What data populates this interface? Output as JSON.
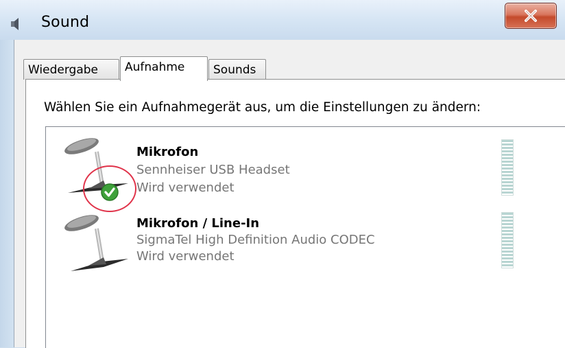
{
  "window": {
    "title": "Sound",
    "icon": "speaker-icon",
    "close_icon": "close-icon"
  },
  "tabs": [
    {
      "label": "Wiedergabe",
      "active": false
    },
    {
      "label": "Aufnahme",
      "active": true
    },
    {
      "label": "Sounds",
      "active": false
    }
  ],
  "instruction": "Wählen Sie ein Aufnahmegerät aus, um die Einstellungen zu ändern:",
  "devices": [
    {
      "name": "Mikrofon",
      "description": "Sennheiser USB Headset",
      "status": "Wird verwendet",
      "icon": "microphone-icon",
      "is_default": true
    },
    {
      "name": "Mikrofon / Line-In",
      "description": "SigmaTel High Definition Audio CODEC",
      "status": "Wird verwendet",
      "icon": "microphone-icon",
      "is_default": false
    }
  ],
  "colors": {
    "highlight_circle": "#e0334a",
    "default_check": "#3ea13a",
    "close_button": "#c44a2c"
  }
}
